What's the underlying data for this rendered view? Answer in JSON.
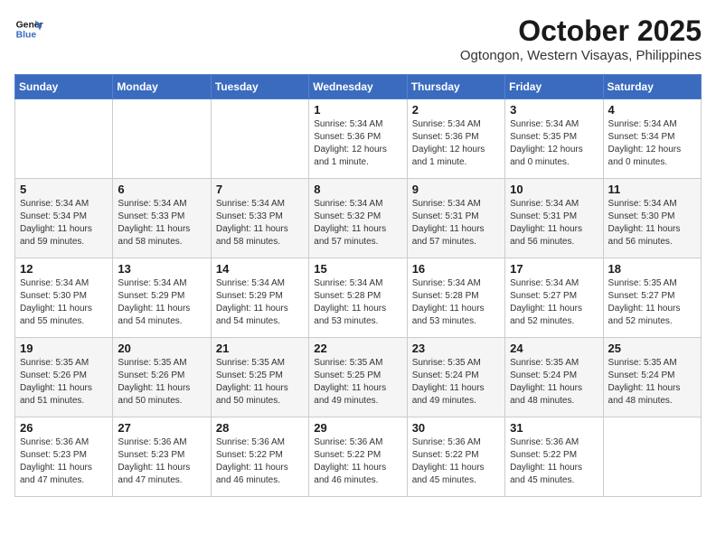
{
  "header": {
    "logo_line1": "General",
    "logo_line2": "Blue",
    "month_year": "October 2025",
    "location": "Ogtongon, Western Visayas, Philippines"
  },
  "days_of_week": [
    "Sunday",
    "Monday",
    "Tuesday",
    "Wednesday",
    "Thursday",
    "Friday",
    "Saturday"
  ],
  "weeks": [
    [
      {
        "day": "",
        "info": ""
      },
      {
        "day": "",
        "info": ""
      },
      {
        "day": "",
        "info": ""
      },
      {
        "day": "1",
        "info": "Sunrise: 5:34 AM\nSunset: 5:36 PM\nDaylight: 12 hours\nand 1 minute."
      },
      {
        "day": "2",
        "info": "Sunrise: 5:34 AM\nSunset: 5:36 PM\nDaylight: 12 hours\nand 1 minute."
      },
      {
        "day": "3",
        "info": "Sunrise: 5:34 AM\nSunset: 5:35 PM\nDaylight: 12 hours\nand 0 minutes."
      },
      {
        "day": "4",
        "info": "Sunrise: 5:34 AM\nSunset: 5:34 PM\nDaylight: 12 hours\nand 0 minutes."
      }
    ],
    [
      {
        "day": "5",
        "info": "Sunrise: 5:34 AM\nSunset: 5:34 PM\nDaylight: 11 hours\nand 59 minutes."
      },
      {
        "day": "6",
        "info": "Sunrise: 5:34 AM\nSunset: 5:33 PM\nDaylight: 11 hours\nand 58 minutes."
      },
      {
        "day": "7",
        "info": "Sunrise: 5:34 AM\nSunset: 5:33 PM\nDaylight: 11 hours\nand 58 minutes."
      },
      {
        "day": "8",
        "info": "Sunrise: 5:34 AM\nSunset: 5:32 PM\nDaylight: 11 hours\nand 57 minutes."
      },
      {
        "day": "9",
        "info": "Sunrise: 5:34 AM\nSunset: 5:31 PM\nDaylight: 11 hours\nand 57 minutes."
      },
      {
        "day": "10",
        "info": "Sunrise: 5:34 AM\nSunset: 5:31 PM\nDaylight: 11 hours\nand 56 minutes."
      },
      {
        "day": "11",
        "info": "Sunrise: 5:34 AM\nSunset: 5:30 PM\nDaylight: 11 hours\nand 56 minutes."
      }
    ],
    [
      {
        "day": "12",
        "info": "Sunrise: 5:34 AM\nSunset: 5:30 PM\nDaylight: 11 hours\nand 55 minutes."
      },
      {
        "day": "13",
        "info": "Sunrise: 5:34 AM\nSunset: 5:29 PM\nDaylight: 11 hours\nand 54 minutes."
      },
      {
        "day": "14",
        "info": "Sunrise: 5:34 AM\nSunset: 5:29 PM\nDaylight: 11 hours\nand 54 minutes."
      },
      {
        "day": "15",
        "info": "Sunrise: 5:34 AM\nSunset: 5:28 PM\nDaylight: 11 hours\nand 53 minutes."
      },
      {
        "day": "16",
        "info": "Sunrise: 5:34 AM\nSunset: 5:28 PM\nDaylight: 11 hours\nand 53 minutes."
      },
      {
        "day": "17",
        "info": "Sunrise: 5:34 AM\nSunset: 5:27 PM\nDaylight: 11 hours\nand 52 minutes."
      },
      {
        "day": "18",
        "info": "Sunrise: 5:35 AM\nSunset: 5:27 PM\nDaylight: 11 hours\nand 52 minutes."
      }
    ],
    [
      {
        "day": "19",
        "info": "Sunrise: 5:35 AM\nSunset: 5:26 PM\nDaylight: 11 hours\nand 51 minutes."
      },
      {
        "day": "20",
        "info": "Sunrise: 5:35 AM\nSunset: 5:26 PM\nDaylight: 11 hours\nand 50 minutes."
      },
      {
        "day": "21",
        "info": "Sunrise: 5:35 AM\nSunset: 5:25 PM\nDaylight: 11 hours\nand 50 minutes."
      },
      {
        "day": "22",
        "info": "Sunrise: 5:35 AM\nSunset: 5:25 PM\nDaylight: 11 hours\nand 49 minutes."
      },
      {
        "day": "23",
        "info": "Sunrise: 5:35 AM\nSunset: 5:24 PM\nDaylight: 11 hours\nand 49 minutes."
      },
      {
        "day": "24",
        "info": "Sunrise: 5:35 AM\nSunset: 5:24 PM\nDaylight: 11 hours\nand 48 minutes."
      },
      {
        "day": "25",
        "info": "Sunrise: 5:35 AM\nSunset: 5:24 PM\nDaylight: 11 hours\nand 48 minutes."
      }
    ],
    [
      {
        "day": "26",
        "info": "Sunrise: 5:36 AM\nSunset: 5:23 PM\nDaylight: 11 hours\nand 47 minutes."
      },
      {
        "day": "27",
        "info": "Sunrise: 5:36 AM\nSunset: 5:23 PM\nDaylight: 11 hours\nand 47 minutes."
      },
      {
        "day": "28",
        "info": "Sunrise: 5:36 AM\nSunset: 5:22 PM\nDaylight: 11 hours\nand 46 minutes."
      },
      {
        "day": "29",
        "info": "Sunrise: 5:36 AM\nSunset: 5:22 PM\nDaylight: 11 hours\nand 46 minutes."
      },
      {
        "day": "30",
        "info": "Sunrise: 5:36 AM\nSunset: 5:22 PM\nDaylight: 11 hours\nand 45 minutes."
      },
      {
        "day": "31",
        "info": "Sunrise: 5:36 AM\nSunset: 5:22 PM\nDaylight: 11 hours\nand 45 minutes."
      },
      {
        "day": "",
        "info": ""
      }
    ]
  ]
}
